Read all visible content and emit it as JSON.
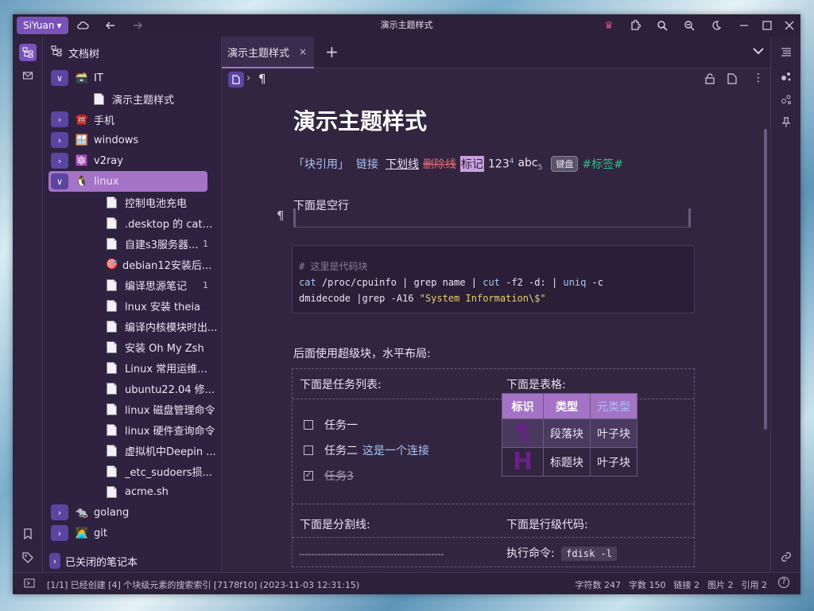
{
  "app": {
    "brand": "SiYuan",
    "window_title": "演示主题样式"
  },
  "tree": {
    "header": "文档树",
    "notebook": {
      "emoji": "🗃️",
      "label": "IT"
    },
    "items": [
      {
        "label": "演示主题样式",
        "kind": "doc",
        "count": ""
      },
      {
        "label": "手机",
        "kind": "folder",
        "emoji": "☎️"
      },
      {
        "label": "windows",
        "kind": "folder",
        "emoji": "🪟"
      },
      {
        "label": "v2ray",
        "kind": "folder",
        "emoji": "⚛️"
      },
      {
        "label": "linux",
        "kind": "folder",
        "emoji": "🐧"
      },
      {
        "label": "控制电池充电",
        "kind": "doc",
        "count": ""
      },
      {
        "label": ".desktop 的 cate...",
        "kind": "doc",
        "count": ""
      },
      {
        "label": "自建s3服务器...",
        "kind": "doc",
        "count": "1"
      },
      {
        "label": "debian12安装后...",
        "kind": "emoji",
        "emoji": "🎯",
        "count": ""
      },
      {
        "label": "编译思源笔记",
        "kind": "doc",
        "count": "1"
      },
      {
        "label": "lnux 安装 theia",
        "kind": "doc",
        "count": ""
      },
      {
        "label": "编译内核模块时出...",
        "kind": "doc",
        "count": ""
      },
      {
        "label": "安装 Oh My Zsh",
        "kind": "doc",
        "count": ""
      },
      {
        "label": "Linux 常用运维命令",
        "kind": "doc",
        "count": ""
      },
      {
        "label": "ubuntu22.04 修...",
        "kind": "doc",
        "count": ""
      },
      {
        "label": "linux 磁盘管理命令",
        "kind": "doc",
        "count": ""
      },
      {
        "label": "linux 硬件查询命令",
        "kind": "doc",
        "count": ""
      },
      {
        "label": "虚拟机中Deepin ...",
        "kind": "doc",
        "count": ""
      },
      {
        "label": "_etc_sudoers损...",
        "kind": "doc",
        "count": ""
      },
      {
        "label": "acme.sh",
        "kind": "doc",
        "count": ""
      },
      {
        "label": "golang",
        "kind": "folder",
        "emoji": "🐀"
      },
      {
        "label": "git",
        "kind": "folder",
        "emoji": "🧑‍💻"
      }
    ],
    "closed_notebooks": "已关闭的笔记本"
  },
  "tab": {
    "label": "演示主题样式",
    "close": "×",
    "add": "+"
  },
  "doc": {
    "title": "演示主题样式",
    "inline": {
      "ref": "「块引用」",
      "link": "链接",
      "underline": "下划线",
      "strike": "删除线",
      "mark": "标记",
      "sup_base": "123",
      "sup": "4",
      "sub_base": "abc",
      "sub": "5",
      "kbd": "键盘",
      "tag": "#标签#"
    },
    "blank_label": "下面是空行",
    "code": {
      "comment": "# 这里是代码块",
      "line2_a": "cat",
      "line2_b": " /proc/cpuinfo | ",
      "line2_c": "grep name",
      "line2_d": " | ",
      "line2_e": "cut",
      "line2_f": " -f2 -d: | ",
      "line2_g": "uniq",
      "line2_h": " -c",
      "line3_a": "dmidecode |grep -A16 ",
      "line3_b": "\"System Information\\$\""
    },
    "superblock_intro": "后面使用超级块，水平布局:",
    "tasks_heading": "下面是任务列表:",
    "table_heading": "下面是表格:",
    "tasks": [
      {
        "label": "任务一",
        "done": false
      },
      {
        "label": "任务二",
        "done": false,
        "link": "这是一个连接"
      },
      {
        "label": "任务3",
        "done": true
      }
    ],
    "table": {
      "headers": [
        "标识",
        "类型",
        "元类型"
      ],
      "rows": [
        [
          "¶",
          "段落块",
          "叶子块"
        ],
        [
          "H",
          "标题块",
          "叶子块"
        ]
      ]
    },
    "divider_heading": "下面是分割线:",
    "inline_code_heading": "下面是行级代码:",
    "divider_text": "----------------------------------------------",
    "exec_label": "执行命令:",
    "inline_code": "fdisk -l"
  },
  "status": {
    "message": "[1/1] 已经创建 [4] 个块级元素的搜索索引 [7178f10] (2023-11-03 12:31:15)",
    "chars": "字符数 247",
    "words": "字数 150",
    "links": "链接 2",
    "images": "图片 2",
    "refs": "引用 2",
    "help": "?"
  },
  "colors": {
    "accent": "#a473c6",
    "brand": "#7a52b8",
    "bg": "#332640",
    "link": "#a9c4f2",
    "strike": "#e06c75",
    "tag": "#2fbf8a"
  }
}
